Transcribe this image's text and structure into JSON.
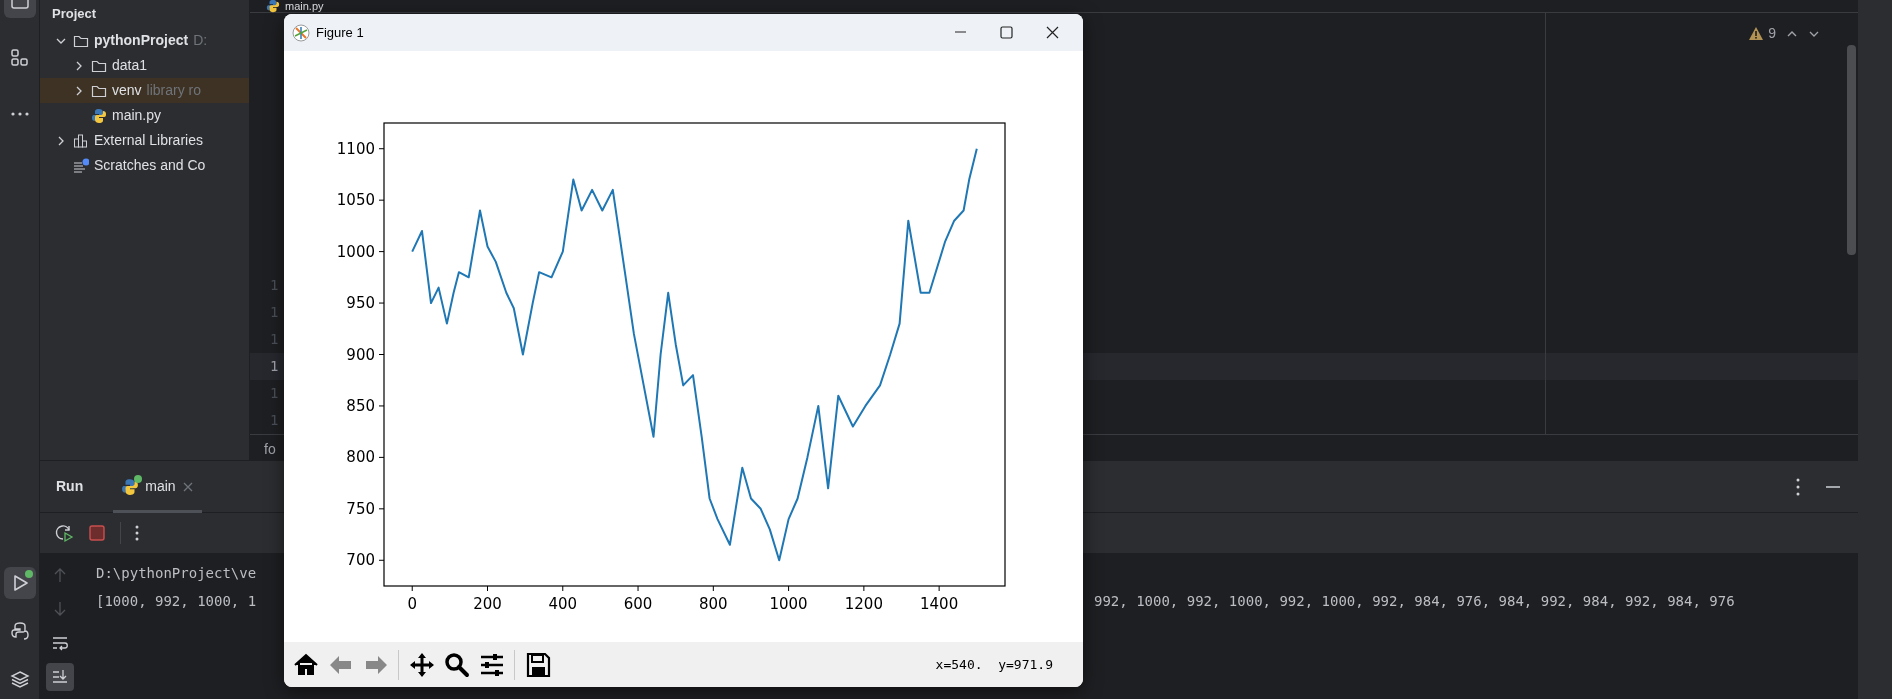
{
  "left_toolbar": {
    "top_items": [
      {
        "selected": true
      },
      {
        "selected": false
      },
      {
        "selected": false
      }
    ],
    "bottom_items": [
      {
        "selected": true,
        "running": true
      },
      {
        "selected": false,
        "running": false
      },
      {
        "selected": false,
        "running": false
      }
    ]
  },
  "project_panel": {
    "header": "Project",
    "tree": [
      {
        "label": "pythonProject",
        "hint": "D:",
        "kind": "folder",
        "expanded": true,
        "selected": false,
        "children": [
          {
            "label": "data1",
            "kind": "folder",
            "expanded": false,
            "selected": false
          },
          {
            "label": "venv",
            "hint": "library ro",
            "kind": "folder",
            "expanded": false,
            "selected": true
          },
          {
            "label": "main.py",
            "kind": "python",
            "selected": false
          }
        ]
      },
      {
        "label": "External Libraries",
        "kind": "library",
        "expanded": false,
        "selected": false
      },
      {
        "label": "Scratches and Co",
        "kind": "scratches",
        "selected": false
      }
    ]
  },
  "editor": {
    "tab": "main.py",
    "inspection_count": "9",
    "breadcrumb": "fo",
    "line_numbers": [
      {
        "text": "1",
        "current": false
      },
      {
        "text": "1",
        "current": false
      },
      {
        "text": "1",
        "current": false
      },
      {
        "text": "1",
        "current": true
      },
      {
        "text": "1",
        "current": false
      },
      {
        "text": "1",
        "current": false
      }
    ]
  },
  "run_panel": {
    "title": "Run",
    "tabs": [
      {
        "label": "main",
        "selected": true,
        "running": true
      }
    ],
    "console_tools": [
      {
        "disabled": true,
        "selected": false
      },
      {
        "disabled": true,
        "selected": false
      },
      {
        "disabled": false,
        "selected": false
      },
      {
        "disabled": false,
        "selected": true
      }
    ],
    "console_lines": [
      "D:\\pythonProject\\ve",
      "[1000, 992, 1000, 1"
    ],
    "console_continuation": "992, 1000, 992, 1000, 992, 1000, 992, 984, 976, 984, 992, 984, 992, 984, 976"
  },
  "figure": {
    "title": "Figure 1",
    "coordinates": "x=540.  y=971.9",
    "chart_data": {
      "type": "line",
      "xlim": [
        -75,
        1575
      ],
      "ylim": [
        675,
        1125
      ],
      "xticks": [
        0,
        200,
        400,
        600,
        800,
        1000,
        1200,
        1400
      ],
      "yticks": [
        700,
        750,
        800,
        850,
        900,
        950,
        1000,
        1050,
        1100
      ],
      "x": [
        0,
        26,
        50,
        70,
        92,
        110,
        124,
        150,
        180,
        200,
        222,
        250,
        270,
        294,
        320,
        337,
        370,
        400,
        428,
        450,
        478,
        505,
        533,
        565,
        589,
        615,
        641,
        660,
        680,
        700,
        720,
        746,
        769,
        790,
        811,
        844,
        877,
        900,
        926,
        950,
        975,
        1000,
        1024,
        1050,
        1079,
        1105,
        1132,
        1171,
        1204,
        1243,
        1270,
        1295,
        1318,
        1351,
        1374,
        1416,
        1440,
        1465,
        1480,
        1500
      ],
      "series": [
        {
          "color": "#1f77b4",
          "values": [
            1000,
            1020,
            950,
            965,
            930,
            960,
            980,
            975,
            1040,
            1005,
            990,
            960,
            945,
            900,
            950,
            980,
            975,
            1000,
            1070,
            1040,
            1060,
            1040,
            1060,
            980,
            920,
            870,
            820,
            900,
            960,
            910,
            870,
            880,
            820,
            760,
            740,
            715,
            790,
            760,
            750,
            730,
            700,
            740,
            760,
            800,
            850,
            770,
            860,
            830,
            850,
            870,
            900,
            930,
            1030,
            960,
            960,
            1010,
            1030,
            1040,
            1070,
            1100
          ]
        }
      ]
    }
  }
}
